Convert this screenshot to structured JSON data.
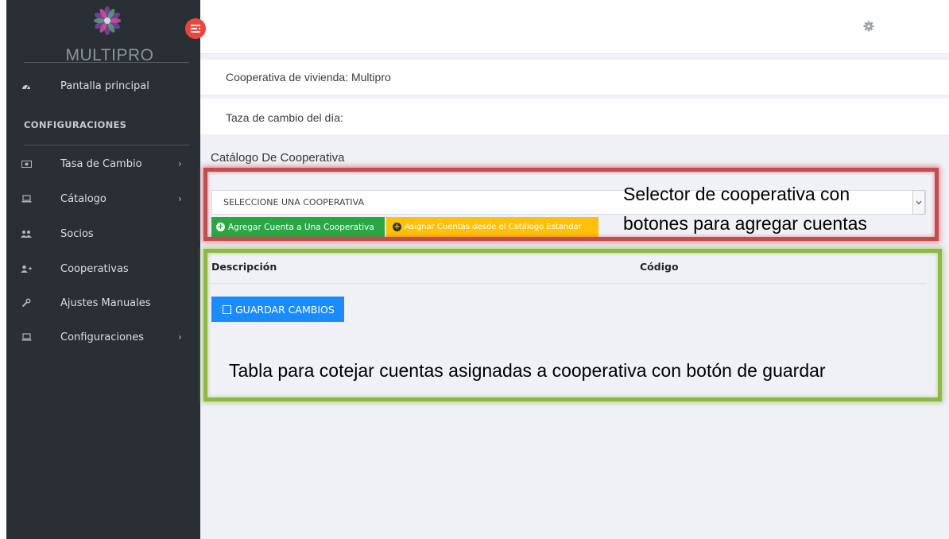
{
  "brand": {
    "name": "MULTIPRO",
    "logo_icon": "flower-logo-icon"
  },
  "sidebar": {
    "dashboard": {
      "label": "Pantalla principal",
      "icon": "dashboard-icon"
    },
    "section_title": "CONFIGURACIONES",
    "items": [
      {
        "label": "Tasa de Cambio",
        "icon": "money-icon",
        "has_submenu": true
      },
      {
        "label": "Cátalogo",
        "icon": "laptop-icon",
        "has_submenu": true
      },
      {
        "label": "Socios",
        "icon": "users-icon",
        "has_submenu": false
      },
      {
        "label": "Cooperativas",
        "icon": "user-plus-icon",
        "has_submenu": false
      },
      {
        "label": "Ajustes Manuales",
        "icon": "wrench-icon",
        "has_submenu": false
      },
      {
        "label": "Configuraciones",
        "icon": "laptop-icon",
        "has_submenu": true
      }
    ],
    "chevron": "›"
  },
  "header": {
    "toggle_icon": "sidebar-toggle-icon",
    "settings_icon": "gear-icon"
  },
  "info": {
    "cooperativa": "Cooperativa de vivienda: Multipro",
    "tasa": "Taza de cambio del día:"
  },
  "card": {
    "title": "Catálogo De Cooperativa",
    "select_value": "SELECCIONE UNA COOPERATIVA",
    "btn_add": "Agregar Cuenta a Una Cooperativa",
    "btn_assign": "Asignar Cuentas desde el Catálogo Estandar",
    "columns": [
      "Descripción",
      "Código"
    ],
    "btn_save": "GUARDAR CAMBIOS"
  },
  "annotations": {
    "selector_line1": "Selector de cooperativa con",
    "selector_line2": "botones para agregar cuentas",
    "table": "Tabla para cotejar cuentas asignadas a cooperativa con botón de guardar"
  },
  "colors": {
    "sidebar_bg": "#2a2f35",
    "toggle_red": "#e8473e",
    "green": "#28a745",
    "yellow": "#ffc107",
    "blue": "#1a8cff",
    "frame_red": "#c44b4f",
    "frame_green": "#8db843"
  }
}
